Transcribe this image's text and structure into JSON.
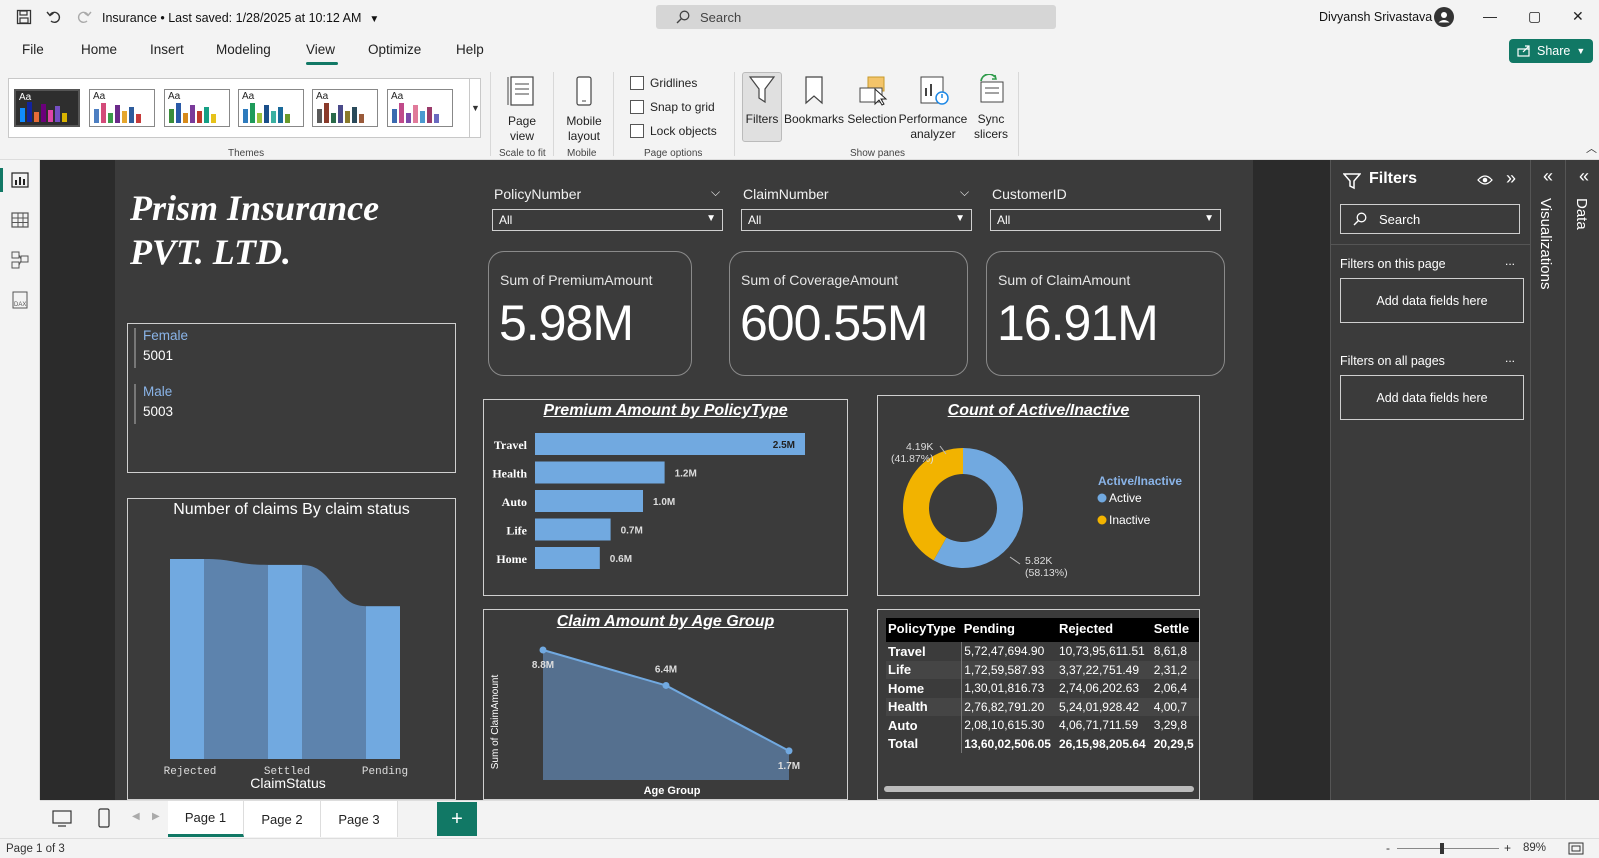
{
  "titlebar": {
    "doc_title": "Insurance • Last saved: 1/28/2025 at 10:12 AM",
    "search_placeholder": "Search",
    "user_name": "Divyansh Srivastava",
    "minimize": "—",
    "maximize": "▢",
    "close": "✕"
  },
  "menu": {
    "items": [
      "File",
      "Home",
      "Insert",
      "Modeling",
      "View",
      "Optimize",
      "Help"
    ],
    "active": "View",
    "share_label": "Share"
  },
  "ribbon": {
    "groups": {
      "themes": "Themes",
      "scale_to_fit": "Scale to fit",
      "mobile": "Mobile",
      "page_options": "Page options",
      "show_panes": "Show panes"
    },
    "page_view": "Page view",
    "mobile_layout": "Mobile layout",
    "gridlines": "Gridlines",
    "snap_to_grid": "Snap to grid",
    "lock_objects": "Lock objects",
    "filters": "Filters",
    "bookmarks": "Bookmarks",
    "selection": "Selection",
    "performance_analyzer": "Performance analyzer",
    "sync_slicers": "Sync slicers",
    "theme_label": "Aa"
  },
  "report": {
    "company_line1": "Prism Insurance",
    "company_line2": "PVT. LTD.",
    "slicers": [
      {
        "label": "PolicyNumber",
        "value": "All"
      },
      {
        "label": "ClaimNumber",
        "value": "All"
      },
      {
        "label": "CustomerID",
        "value": "All"
      }
    ],
    "cards": [
      {
        "label": "Sum of PremiumAmount",
        "value": "5.98M"
      },
      {
        "label": "Sum of CoverageAmount",
        "value": "600.55M"
      },
      {
        "label": "Sum of ClaimAmount",
        "value": "16.91M"
      }
    ],
    "gender": [
      {
        "label": "Female",
        "value": "5001"
      },
      {
        "label": "Male",
        "value": "5003"
      }
    ]
  },
  "chart_data": [
    {
      "type": "bar",
      "title": "Premium Amount by PolicyType",
      "categories": [
        "Travel",
        "Health",
        "Auto",
        "Life",
        "Home"
      ],
      "values": [
        2.5,
        1.2,
        1.0,
        0.7,
        0.6
      ],
      "labels": [
        "2.5M",
        "1.2M",
        "1.0M",
        "0.7M",
        "0.6M"
      ],
      "color": "#71a9e0"
    },
    {
      "type": "pie",
      "title": "Count of Active/Inactive",
      "legend_title": "Active/Inactive",
      "categories": [
        "Active",
        "Inactive"
      ],
      "values": [
        5820,
        4190
      ],
      "labels": [
        "5.82K",
        "4.19K"
      ],
      "percents": [
        "(58.13%)",
        "(41.87%)"
      ],
      "colors": [
        "#71a9e0",
        "#f2b300"
      ]
    },
    {
      "type": "bar",
      "title": "Number of claims By claim status",
      "xlabel": "ClaimStatus",
      "categories": [
        "Rejected",
        "Settled",
        "Pending"
      ],
      "values": [
        3390,
        3290,
        2590
      ],
      "color": "#71a9e0"
    },
    {
      "type": "area",
      "title": "Claim Amount by Age Group",
      "xlabel": "Age Group",
      "ylabel": "Sum of ClaimAmount",
      "values": [
        8.8,
        6.4,
        1.7
      ],
      "labels": [
        "8.8M",
        "6.4M",
        "1.7M"
      ],
      "color": "#71a9e0"
    },
    {
      "type": "table",
      "columns": [
        "PolicyType",
        "Pending",
        "Rejected",
        "Settle"
      ],
      "rows": [
        [
          "Travel",
          "5,72,47,694.90",
          "10,73,95,611.51",
          "8,61,8"
        ],
        [
          "Life",
          "1,72,59,587.93",
          "3,37,22,751.49",
          "2,31,2"
        ],
        [
          "Home",
          "1,30,01,816.73",
          "2,74,06,202.63",
          "2,06,4"
        ],
        [
          "Health",
          "2,76,82,791.20",
          "5,24,01,928.42",
          "4,00,7"
        ],
        [
          "Auto",
          "2,08,10,615.30",
          "4,06,71,711.59",
          "3,29,8"
        ],
        [
          "Total",
          "13,60,02,506.05",
          "26,15,98,205.64",
          "20,29,5"
        ]
      ]
    }
  ],
  "filters_pane": {
    "title": "Filters",
    "search_placeholder": "Search",
    "on_this_page": "Filters on this page",
    "on_all_pages": "Filters on all pages",
    "add_fields": "Add data fields here",
    "more": "..."
  },
  "side_panes": {
    "visualizations": "Visualizations",
    "data": "Data"
  },
  "pages": {
    "tabs": [
      "Page 1",
      "Page 2",
      "Page 3"
    ],
    "active": "Page 1",
    "add": "+"
  },
  "status": {
    "page_info": "Page 1 of 3",
    "zoom": "89%",
    "zoom_minus": "-",
    "zoom_plus": "+"
  }
}
